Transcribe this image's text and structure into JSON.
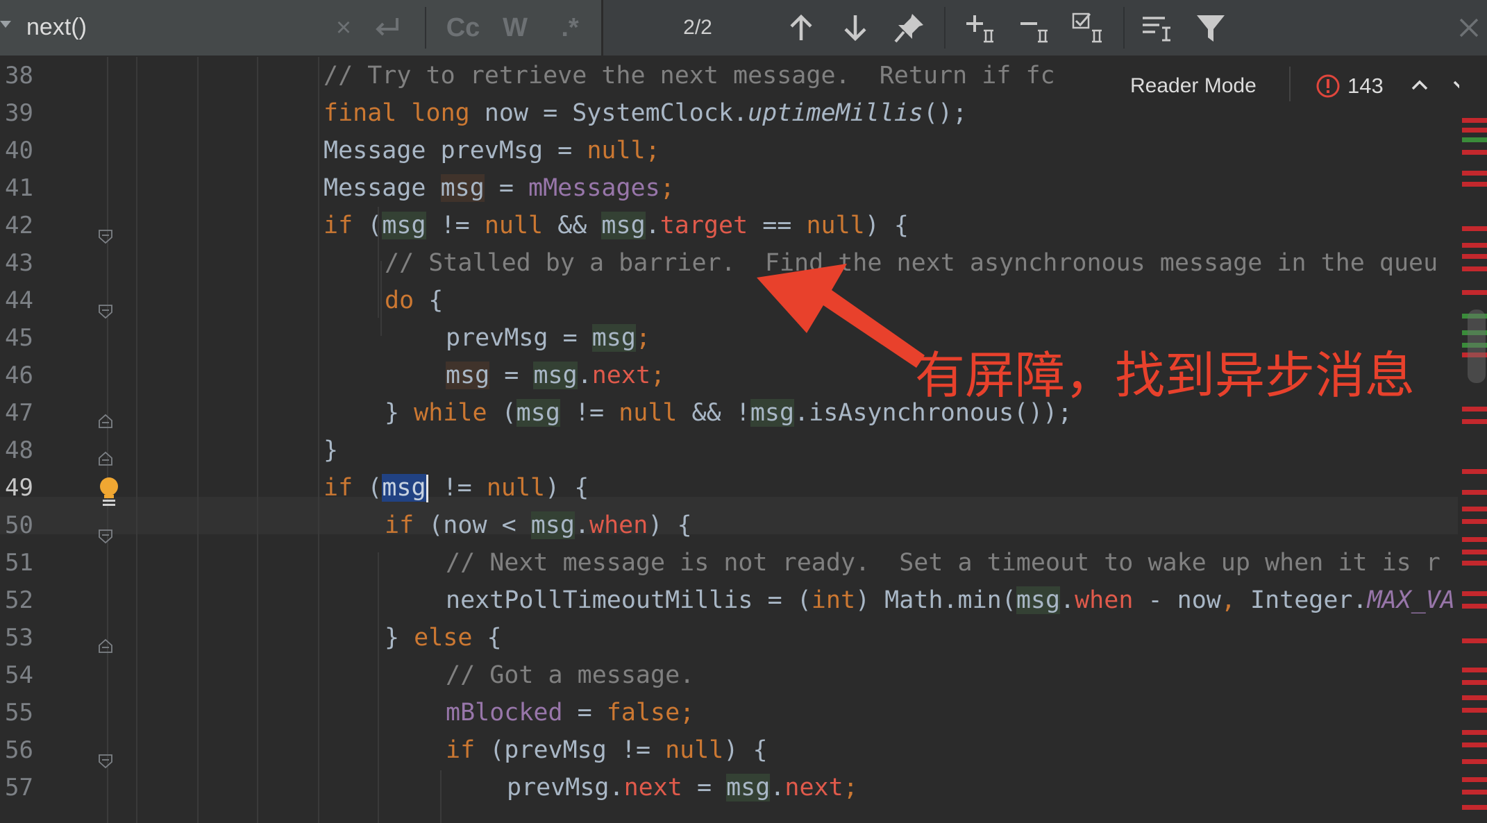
{
  "search": {
    "query": "next()",
    "clear_glyph": "×",
    "match_case": "Cc",
    "words": "W",
    "regex": ".*",
    "match_count": "2/2"
  },
  "reader": {
    "label": "Reader Mode",
    "error_count": "143"
  },
  "annotation": {
    "text": "有屏障，找到异步消息"
  },
  "colors": {
    "editor_bg": "#2b2b2b",
    "keyword": "#cc7832",
    "comment": "#808080",
    "field": "#9876aa",
    "annotation": "#e8412c",
    "error_marker": "#c4282d"
  },
  "code": {
    "ln38": "38",
    "ln39": "39",
    "ln40": "40",
    "ln41": "41",
    "ln42": "42",
    "ln43": "43",
    "ln44": "44",
    "ln45": "45",
    "ln46": "46",
    "ln47": "47",
    "ln48": "48",
    "ln49": "49",
    "ln50": "50",
    "ln51": "51",
    "ln52": "52",
    "ln53": "53",
    "ln54": "54",
    "ln55": "55",
    "ln56": "56",
    "ln57": "57",
    "c38": "// Try to retrieve the next message.  Return if fc",
    "t_final": "final",
    "t_long": "long",
    "t_now_assign": " now = SystemClock.",
    "t_uptime": "uptimeMillis",
    "t_call_end": "();",
    "t_message": "Message",
    "t_prevMsg_decl": " prevMsg = ",
    "t_null": "null",
    "t_semi": ";",
    "t_msg": "msg",
    "t_space": " ",
    "t_eq": " = ",
    "t_mMessages": "mMessages",
    "t_if": "if",
    "t_paren_open": " (",
    "t_ne_null": " != ",
    "t_and": " && ",
    "t_dot": ".",
    "t_target": "target",
    "t_eqeq": " == ",
    "t_close_brace": ") {",
    "c43": "// Stalled by a barrier.  Find the next asynchronous message in the queu",
    "t_do": "do",
    "t_brace": " {",
    "t_prevMsg_assign": "prevMsg = ",
    "t_next": "next",
    "t_rbrace": "} ",
    "t_while": "while",
    "t_not": " && !",
    "t_isAsync": "isAsynchronous());",
    "t_only_rbrace": "}",
    "t_now_lt": " (now < ",
    "t_when": "when",
    "c51": "// Next message is not ready.  Set a timeout to wake up when it is r",
    "t_nextPoll": "nextPollTimeoutMillis = (",
    "t_int": "int",
    "t_mathmin": ") Math.min(",
    "t_minus_now": " - now",
    "t_comma": ",",
    "t_integer": " Integer.",
    "t_maxv": "MAX_VA",
    "t_else": "else",
    "c54": "// Got a message.",
    "t_mBlocked": "mBlocked",
    "t_false": "false",
    "t_prevMsg_paren": " (prevMsg != ",
    "t_prevMsg_dot": "prevMsg."
  }
}
